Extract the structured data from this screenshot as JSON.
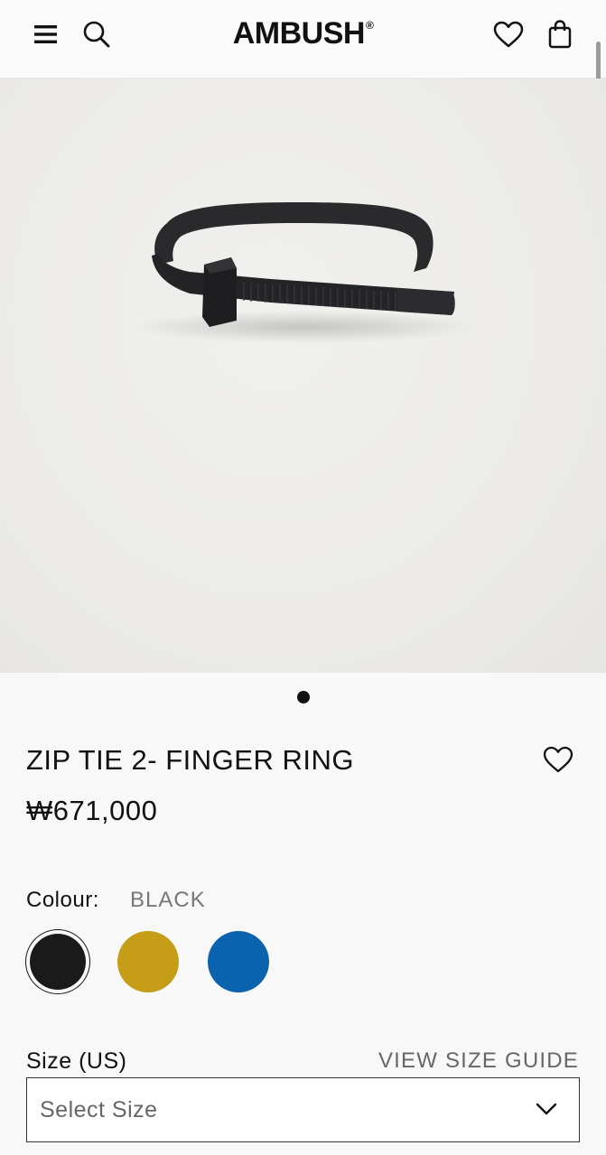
{
  "header": {
    "brand": "AMBUSH",
    "brand_mark": "®",
    "icons": [
      "menu-icon",
      "search-icon",
      "heart-icon",
      "shopping-bag-icon"
    ]
  },
  "gallery": {
    "image_alt": "Black zip tie ring",
    "active_page": 1,
    "page_count": 1
  },
  "product": {
    "title": "ZIP TIE 2- FINGER RING",
    "price": "₩671,000",
    "colour_label": "Colour:",
    "colour_value": "BLACK",
    "colours": [
      {
        "name": "black",
        "hex": "#1a1a1a",
        "selected": true
      },
      {
        "name": "gold",
        "hex": "#c59d17",
        "selected": false
      },
      {
        "name": "blue",
        "hex": "#0b63ad",
        "selected": false
      }
    ],
    "size_label": "Size (US)",
    "size_guide": "VIEW SIZE GUIDE",
    "size_placeholder": "Select Size"
  }
}
